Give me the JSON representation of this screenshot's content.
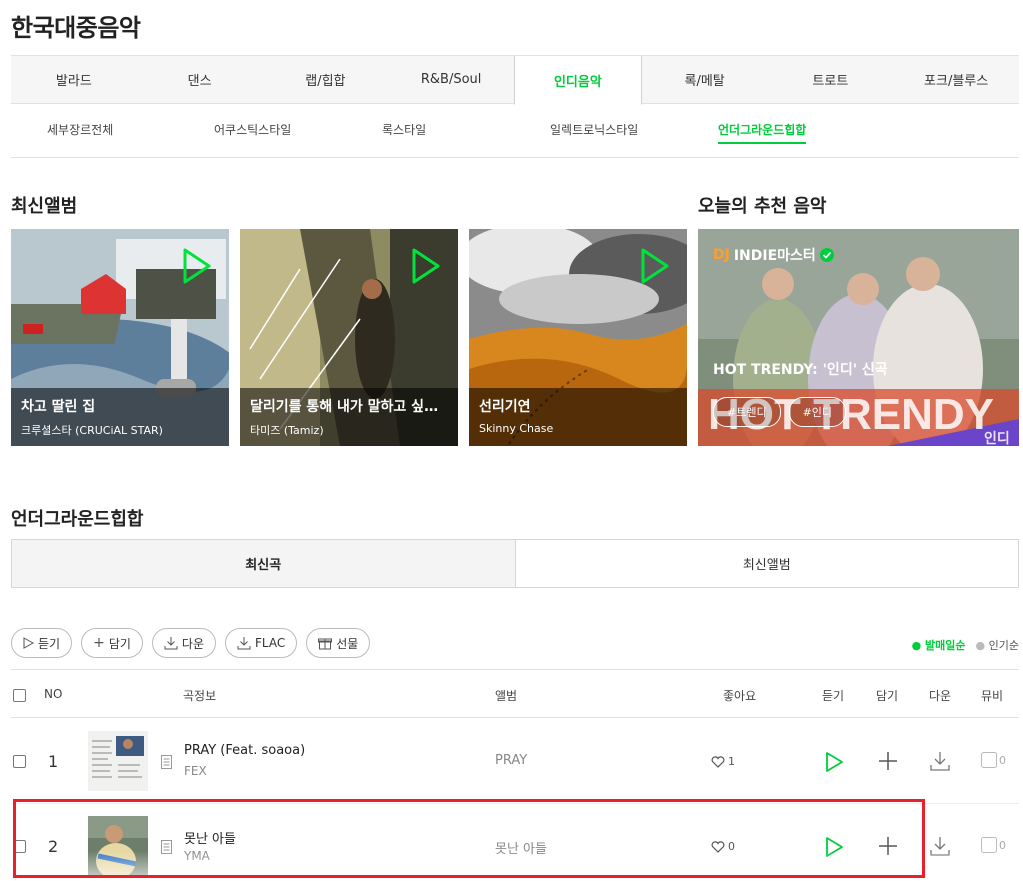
{
  "page_title": "한국대중음악",
  "genre_tabs": [
    "발라드",
    "댄스",
    "랩/힙합",
    "R&B/Soul",
    "인디음악",
    "록/메탈",
    "트로트",
    "포크/블루스"
  ],
  "sub_tabs": [
    "세부장르전체",
    "어쿠스틱스타일",
    "록스타일",
    "일렉트로닉스타일",
    "언더그라운드힙합"
  ],
  "latest_albums_title": "최신앨범",
  "recommend_title": "오늘의 추천 음악",
  "albums": [
    {
      "name": "차고 딸린 집",
      "artist": "크루셜스타 (CRUCiAL STAR)"
    },
    {
      "name": "달리기를 통해 내가 말하고 싶은...",
      "artist": "타미즈 (Tamiz)"
    },
    {
      "name": "선리기연",
      "artist": "Skinny Chase"
    }
  ],
  "recommend": {
    "dj_label": "DJ",
    "dj_name": "INDIE마스터",
    "title": "HOT TRENDY: '인디' 신곡",
    "tags": [
      "#트렌디",
      "#인디"
    ],
    "big_text": "HOT TRENDY",
    "side_text": "인디"
  },
  "section_title": "언더그라운드힙합",
  "list_tabs": [
    "최신곡",
    "최신앨범"
  ],
  "actions": [
    "듣기",
    "담기",
    "다운",
    "FLAC",
    "선물"
  ],
  "sort": {
    "on": "발매일순",
    "off": "인기순"
  },
  "columns": {
    "no": "NO",
    "song": "곡정보",
    "album": "앨범",
    "likes": "좋아요",
    "play": "듣기",
    "add": "담기",
    "down": "다운",
    "mv": "뮤비"
  },
  "rows": [
    {
      "rank": "1",
      "title": "PRAY (Feat. soaoa)",
      "artist": "FEX",
      "album": "PRAY",
      "likes": "1",
      "mv": "0"
    },
    {
      "rank": "2",
      "title": "못난 아들",
      "artist": "YMA",
      "album": "못난 아들",
      "likes": "0",
      "mv": "0"
    }
  ],
  "colors": {
    "accent": "#00cd3c",
    "highlight": "#e8202a"
  }
}
